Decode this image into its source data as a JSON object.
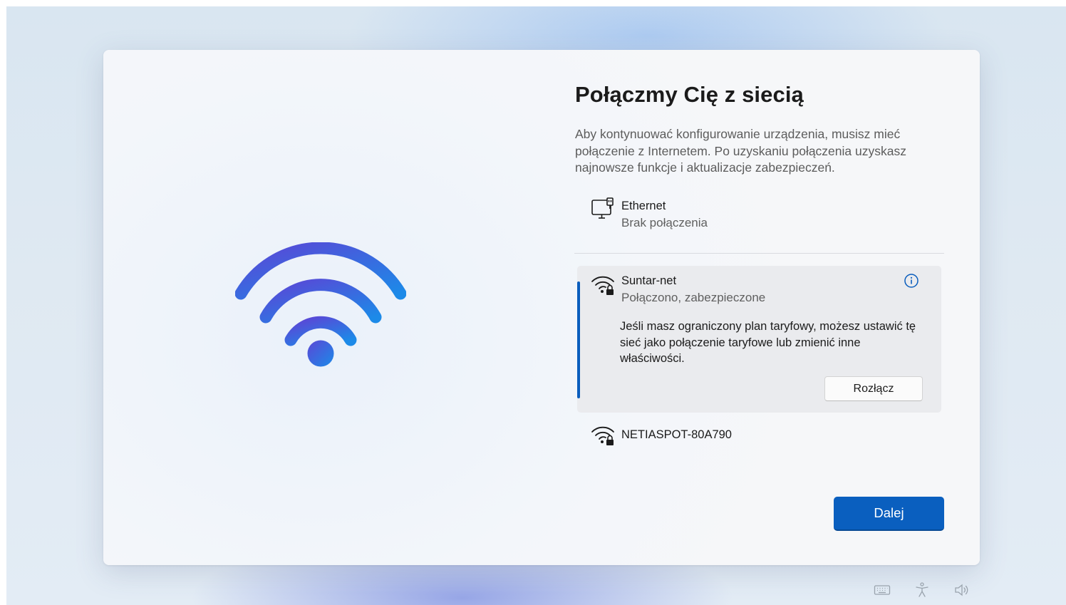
{
  "page": {
    "title": "Połączmy Cię z siecią",
    "description": "Aby kontynuować konfigurowanie urządzenia, musisz mieć połączenie z Internetem. Po uzyskaniu połączenia uzyskasz najnowsze funkcje i aktualizacje zabezpieczeń."
  },
  "networks": {
    "ethernet": {
      "icon": "ethernet-icon",
      "name": "Ethernet",
      "status": "Brak połączenia"
    },
    "selected": {
      "icon": "wifi-secured-icon",
      "name": "Suntar-net",
      "status": "Połączono, zabezpieczone",
      "info_text": "Jeśli masz ograniczony plan taryfowy, możesz ustawić tę sieć jako połączenie taryfowe lub zmienić inne właściwości.",
      "disconnect_label": "Rozłącz",
      "info_icon": "info-icon"
    },
    "other": {
      "icon": "wifi-secured-icon",
      "name": "NETIASPOT-80A790"
    }
  },
  "footer": {
    "next_label": "Dalej"
  },
  "taskbar": {
    "icons": [
      "keyboard-icon",
      "accessibility-icon",
      "volume-icon"
    ]
  },
  "colors": {
    "accent": "#0a5fbf",
    "illustration_gradient": [
      "#5b4fd9",
      "#1f84e6"
    ]
  }
}
